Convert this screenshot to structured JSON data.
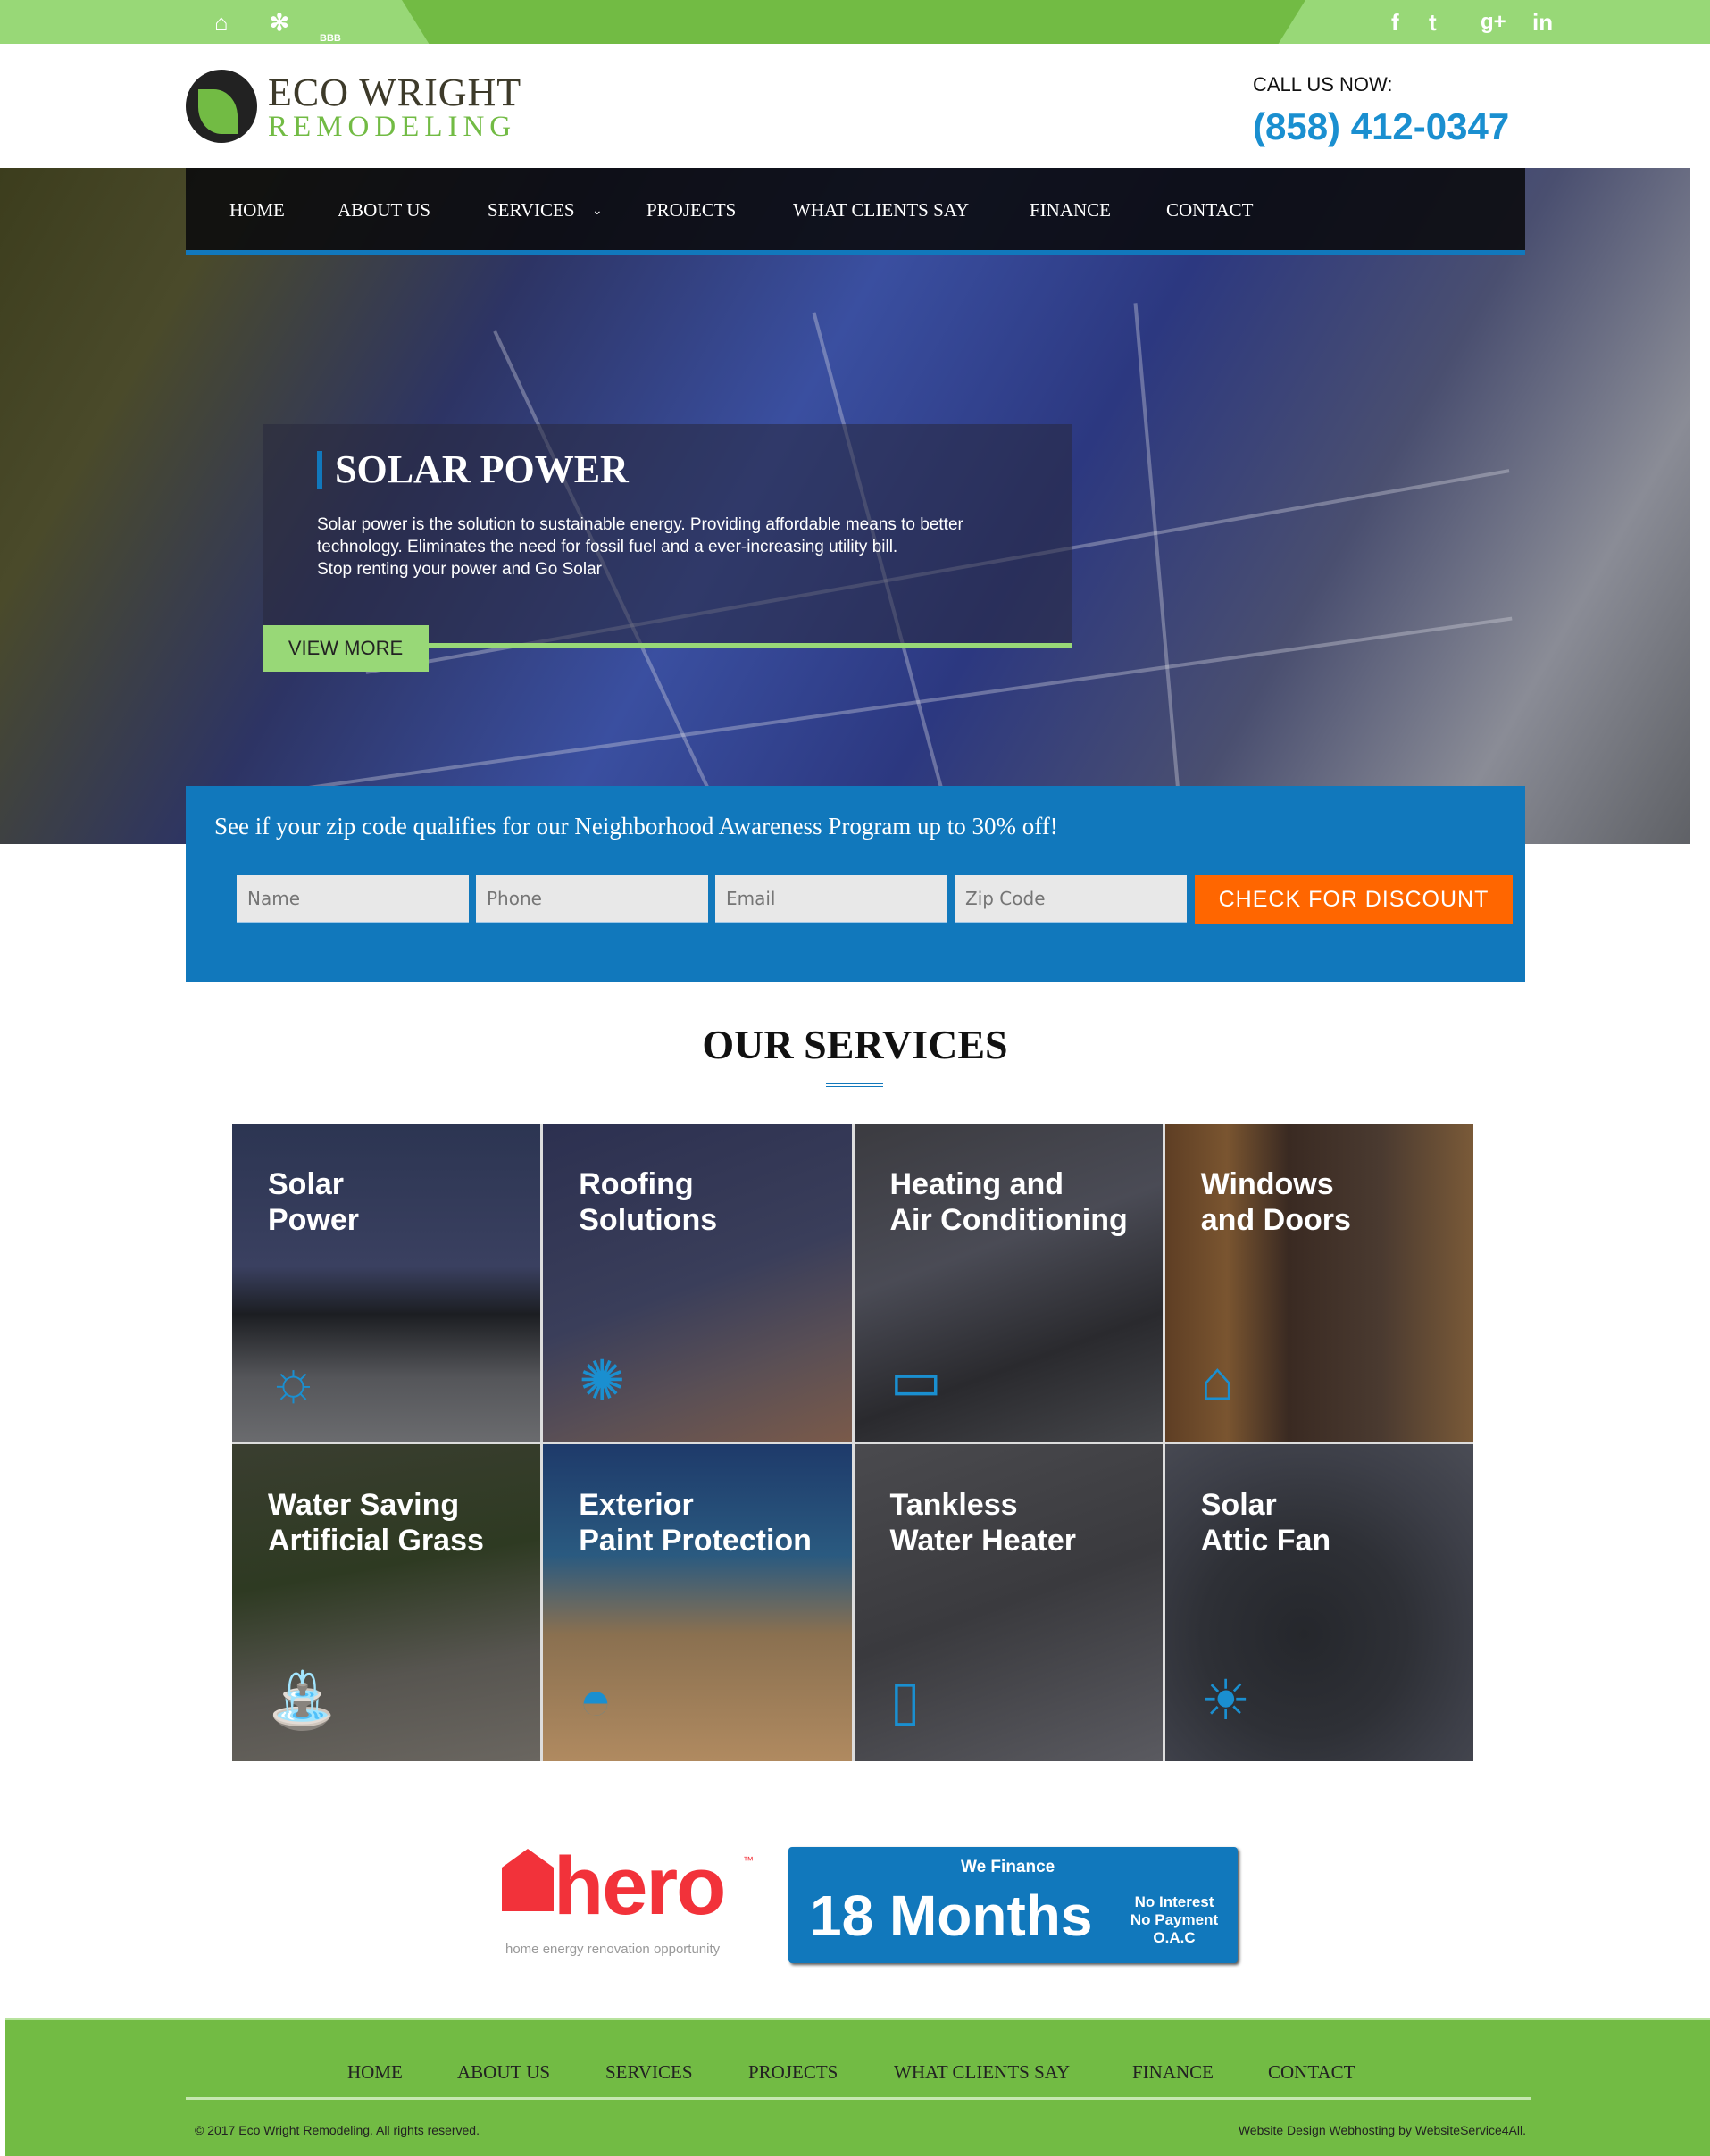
{
  "topbar": {
    "left_icons": [
      "home-advisor-icon",
      "yelp-icon",
      "bbb-icon"
    ],
    "bbb_text": "BBB",
    "social_icons": [
      "facebook-icon",
      "twitter-icon",
      "google-plus-icon",
      "linkedin-icon"
    ],
    "social_glyphs": [
      "f",
      "t",
      "g+",
      "in"
    ]
  },
  "brand": {
    "name_line1": "ECO WRIGHT",
    "name_line2": "REMODELING"
  },
  "contact": {
    "call_label": "CALL US NOW:",
    "phone": "(858) 412-0347"
  },
  "nav": {
    "items": [
      "HOME",
      "ABOUT US",
      "SERVICES",
      "PROJECTS",
      "WHAT CLIENTS SAY",
      "FINANCE",
      "CONTACT"
    ]
  },
  "hero": {
    "title": "SOLAR POWER",
    "text_line1": "Solar power is the solution to sustainable energy. Providing affordable means to better",
    "text_line2": "technology. Eliminates the need for fossil fuel and a ever-increasing utility bill.",
    "text_line3": "Stop renting your power and Go Solar",
    "cta": "VIEW MORE"
  },
  "discount": {
    "headline": "See if your zip code qualifies for our Neighborhood Awareness Program up to 30% off!",
    "placeholders": {
      "name": "Name",
      "phone": "Phone",
      "email": "Email",
      "zip": "Zip Code"
    },
    "button": "CHECK FOR DISCOUNT"
  },
  "services": {
    "title": "OUR SERVICES",
    "items": [
      {
        "label": "Solar\nPower",
        "icon": "solar-sun-icon"
      },
      {
        "label": "Roofing\nSolutions",
        "icon": "roofing-icon"
      },
      {
        "label": "Heating and\nAir Conditioning",
        "icon": "air-conditioner-icon"
      },
      {
        "label": "Windows\nand Doors",
        "icon": "house-icon"
      },
      {
        "label": "Water Saving\nArtificial Grass",
        "icon": "sprinkler-icon"
      },
      {
        "label": "Exterior\nPaint Protection",
        "icon": "paint-icon"
      },
      {
        "label": "Tankless\nWater Heater",
        "icon": "water-heater-icon"
      },
      {
        "label": "Solar\nAttic Fan",
        "icon": "sunrise-icon"
      }
    ]
  },
  "promo": {
    "hero_word": "hero",
    "hero_tm": "™",
    "hero_tagline": "home energy renovation opportunity",
    "finance_top": "We Finance",
    "finance_big": "18 Months",
    "finance_l1": "No Interest",
    "finance_l2": "No Payment",
    "finance_l3": "O.A.C"
  },
  "footer": {
    "nav": [
      "HOME",
      "ABOUT US",
      "SERVICES",
      "PROJECTS",
      "WHAT CLIENTS SAY",
      "FINANCE",
      "CONTACT"
    ],
    "copyright": "© 2017 Eco Wright Remodeling. All rights reserved.",
    "credit": "Website Design Webhosting by WebsiteService4All."
  },
  "colors": {
    "green": "#72bb44",
    "light_green": "#98d877",
    "blue": "#1178bc",
    "orange": "#ff6600",
    "phone_blue": "#1a8fd0"
  }
}
